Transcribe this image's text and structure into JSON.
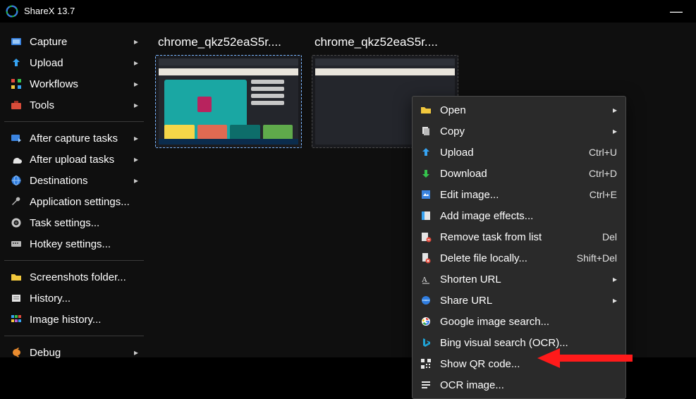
{
  "app": {
    "title": "ShareX 13.7"
  },
  "sidebar": {
    "items": [
      {
        "label": "Capture",
        "chevron": true
      },
      {
        "label": "Upload",
        "chevron": true
      },
      {
        "label": "Workflows",
        "chevron": true
      },
      {
        "label": "Tools",
        "chevron": true
      }
    ],
    "group2": [
      {
        "label": "After capture tasks",
        "chevron": true
      },
      {
        "label": "After upload tasks",
        "chevron": true
      },
      {
        "label": "Destinations",
        "chevron": true
      },
      {
        "label": "Application settings..."
      },
      {
        "label": "Task settings..."
      },
      {
        "label": "Hotkey settings..."
      }
    ],
    "group3": [
      {
        "label": "Screenshots folder..."
      },
      {
        "label": "History..."
      },
      {
        "label": "Image history..."
      }
    ],
    "group4": [
      {
        "label": "Debug",
        "chevron": true
      }
    ]
  },
  "thumbs": [
    {
      "label": "chrome_qkz52eaS5r...."
    },
    {
      "label": "chrome_qkz52eaS5r...."
    }
  ],
  "ctx": {
    "items": [
      {
        "label": "Open",
        "sub": true
      },
      {
        "label": "Copy",
        "sub": true
      },
      {
        "label": "Upload",
        "short": "Ctrl+U"
      },
      {
        "label": "Download",
        "short": "Ctrl+D"
      },
      {
        "label": "Edit image...",
        "short": "Ctrl+E"
      },
      {
        "label": "Add image effects..."
      },
      {
        "label": "Remove task from list",
        "short": "Del"
      },
      {
        "label": "Delete file locally...",
        "short": "Shift+Del"
      },
      {
        "label": "Shorten URL",
        "sub": true
      },
      {
        "label": "Share URL",
        "sub": true
      },
      {
        "label": "Google image search..."
      },
      {
        "label": "Bing visual search (OCR)..."
      },
      {
        "label": "Show QR code..."
      },
      {
        "label": "OCR image..."
      }
    ]
  }
}
